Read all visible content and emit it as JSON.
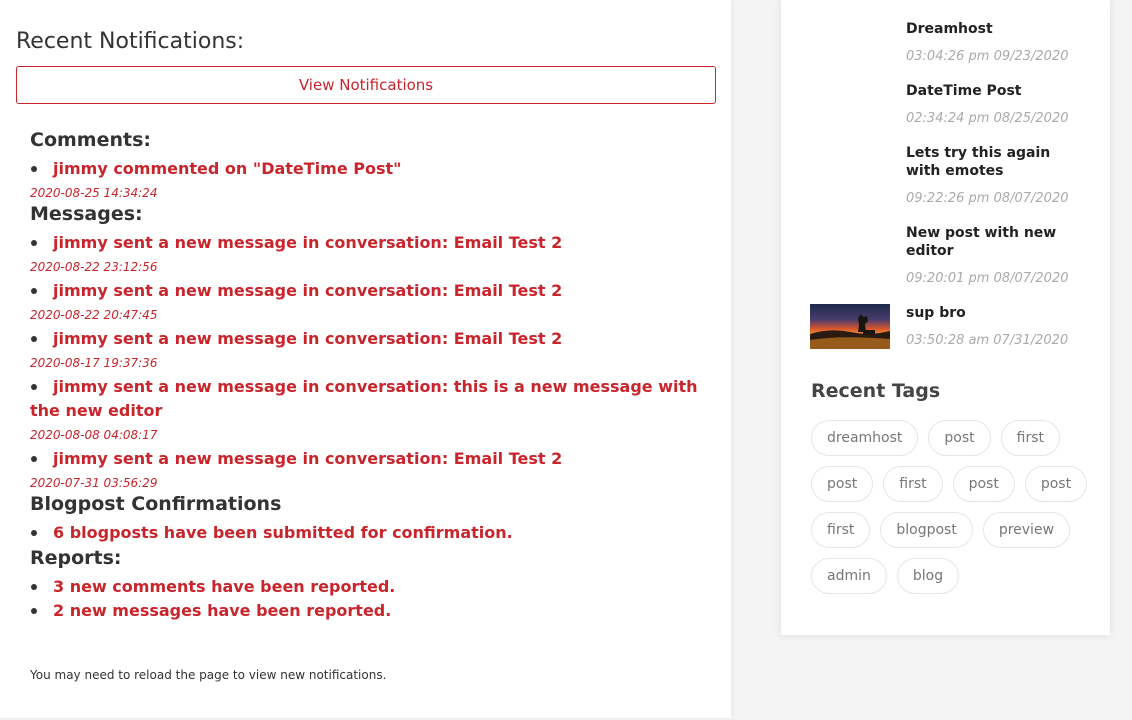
{
  "notifications": {
    "title": "Recent Notifications:",
    "view_button": "View Notifications",
    "sections": {
      "comments": {
        "title": "Comments:",
        "items": [
          {
            "text": "jimmy commented on \"DateTime Post\"",
            "time": "2020-08-25 14:34:24"
          }
        ]
      },
      "messages": {
        "title": "Messages:",
        "items": [
          {
            "text": "jimmy sent a new message in conversation: Email Test 2",
            "time": "2020-08-22 23:12:56"
          },
          {
            "text": "jimmy sent a new message in conversation: Email Test 2",
            "time": "2020-08-22 20:47:45"
          },
          {
            "text": "jimmy sent a new message in conversation: Email Test 2",
            "time": "2020-08-17 19:37:36"
          },
          {
            "text": "jimmy sent a new message in conversation: this is a new message with the new editor",
            "time": "2020-08-08 04:08:17"
          },
          {
            "text": "jimmy sent a new message in conversation: Email Test 2",
            "time": "2020-07-31 03:56:29"
          }
        ]
      },
      "blogpost": {
        "title": "Blogpost Confirmations",
        "items": [
          {
            "text": "6 blogposts have been submitted for confirmation."
          }
        ]
      },
      "reports": {
        "title": "Reports:",
        "items": [
          {
            "text": "3 new comments have been reported."
          },
          {
            "text": "2 new messages have been reported."
          }
        ]
      }
    },
    "reload_note": "You may need to reload the page to view new notifications."
  },
  "recent_posts": [
    {
      "title": "Dreamhost",
      "date": "03:04:26 pm 09/23/2020"
    },
    {
      "title": "DateTime Post",
      "date": "02:34:24 pm 08/25/2020"
    },
    {
      "title": "Lets try this again with emotes",
      "date": "09:22:26 pm 08/07/2020"
    },
    {
      "title": "New post with new editor",
      "date": "09:20:01 pm 08/07/2020"
    },
    {
      "title": "sup bro",
      "date": "03:50:28 am 07/31/2020",
      "has_thumbnail": true
    }
  ],
  "recent_tags": {
    "title": "Recent Tags",
    "tags": [
      "dreamhost",
      "post",
      "first",
      "post",
      "first",
      "post",
      "post",
      "first",
      "blogpost",
      "preview",
      "admin",
      "blog"
    ]
  },
  "colors": {
    "accent": "#c9252c",
    "text": "#333333",
    "muted": "#aaaaaa"
  }
}
